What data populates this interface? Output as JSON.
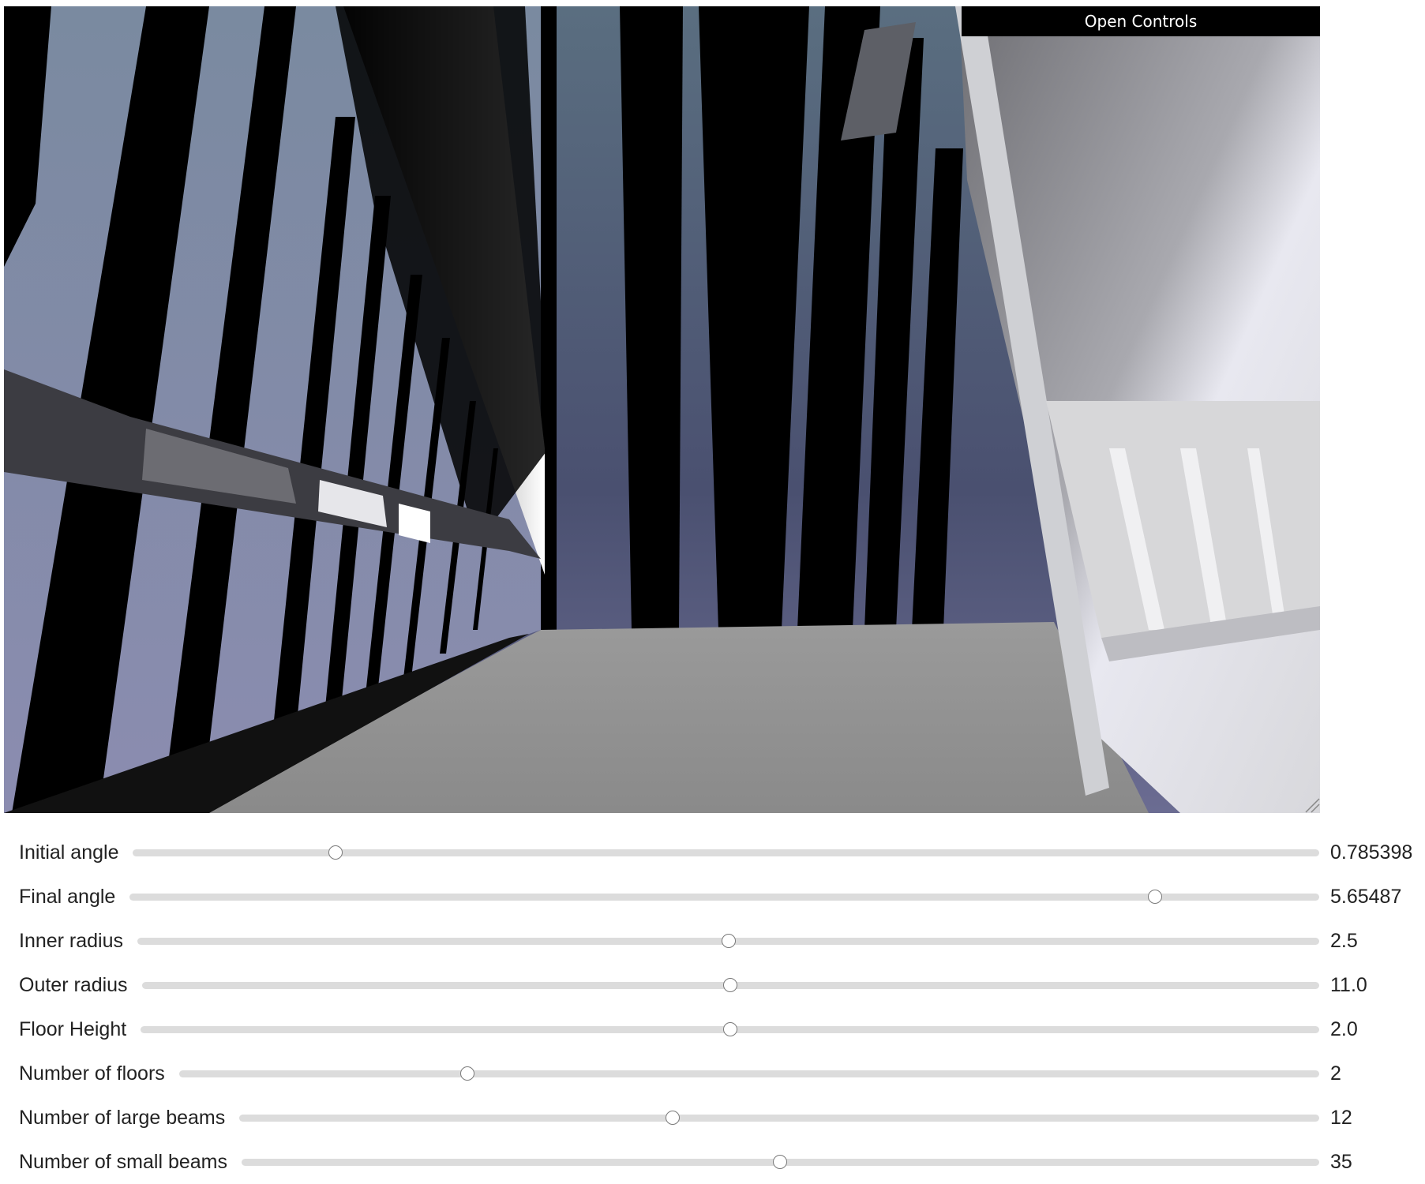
{
  "viewport": {
    "open_controls_label": "Open Controls"
  },
  "controls": [
    {
      "label": "Initial angle",
      "value": "0.785398",
      "position": 0.171
    },
    {
      "label": "Final angle",
      "value": "5.65487",
      "position": 0.862
    },
    {
      "label": "Inner radius",
      "value": "2.5",
      "position": 0.5
    },
    {
      "label": "Outer radius",
      "value": "11.0",
      "position": 0.5
    },
    {
      "label": "Floor Height",
      "value": "2.0",
      "position": 0.5
    },
    {
      "label": "Number of floors",
      "value": "2",
      "position": 0.253
    },
    {
      "label": "Number of large beams",
      "value": "12",
      "position": 0.401
    },
    {
      "label": "Number of small beams",
      "value": "35",
      "position": 0.5
    }
  ]
}
